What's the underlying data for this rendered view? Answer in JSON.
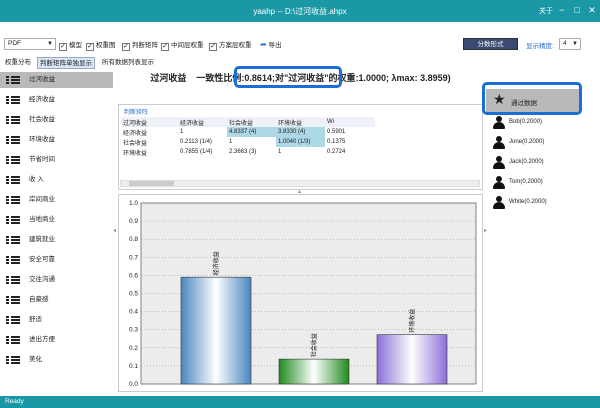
{
  "window": {
    "title": "yaahp -- D:\\过河收益.ahpx",
    "about": "关于",
    "minimize": "−",
    "maximize": "□",
    "close": "✕"
  },
  "toolbar": {
    "format_value": "PDF",
    "checks": [
      {
        "label": "模型",
        "checked": true
      },
      {
        "label": "权重图",
        "checked": true
      },
      {
        "label": "判断矩阵",
        "checked": true
      },
      {
        "label": "中间层权重",
        "checked": true
      },
      {
        "label": "方案层权重",
        "checked": true
      }
    ],
    "export_label": "导出",
    "score_button": "分数形式",
    "precision_label": "显示精度:",
    "precision_value": "4"
  },
  "tabs": [
    {
      "label": "权重分布",
      "active": false
    },
    {
      "label": "判断矩阵单独显示",
      "active": true
    },
    {
      "label": "所有数据列表显示",
      "active": false
    }
  ],
  "nav": [
    {
      "label": "过河收益"
    },
    {
      "label": "经济收益"
    },
    {
      "label": "社会收益"
    },
    {
      "label": "环境收益"
    },
    {
      "label": "节省时间"
    },
    {
      "label": "收 入"
    },
    {
      "label": "岸间商业"
    },
    {
      "label": "当地商业"
    },
    {
      "label": "建筑就业"
    },
    {
      "label": "安全可靠"
    },
    {
      "label": "交往沟通"
    },
    {
      "label": "自豪感"
    },
    {
      "label": "舒适"
    },
    {
      "label": "进出方便"
    },
    {
      "label": "美化"
    }
  ],
  "headline": {
    "node": "过河收益",
    "consistency_label": "一致性比例:",
    "consistency_value": "0.8614;",
    "weight_text": "对\"过河收益\"的权重:",
    "weight_value": "1.0000;",
    "lambda_text": "λmax:",
    "lambda_value": "3.8959)"
  },
  "matrix": {
    "title": "判断矩阵",
    "header": [
      "过河收益",
      "经济收益",
      "社会收益",
      "环境收益",
      "Wi"
    ],
    "rows": [
      [
        "经济收益",
        "1",
        "4.8337 (4)",
        "3.8330 (4)",
        "0.5901"
      ],
      [
        "社会收益",
        "0.2113 (1/4)",
        "1",
        "1.0040 (1/3)",
        "0.1375"
      ],
      [
        "环境收益",
        "0.7855 (1/4)",
        "2.3663 (3)",
        "1",
        "0.2724"
      ]
    ]
  },
  "chart_data": {
    "type": "bar",
    "categories": [
      "经济收益",
      "社会收益",
      "环境收益"
    ],
    "values": [
      0.5901,
      0.1375,
      0.2724
    ],
    "colors": [
      "#4a86c0",
      "#1f8a1f",
      "#8a6fd8"
    ],
    "ylim": [
      0,
      1.0
    ],
    "yticks": [
      "0.0",
      "0.1",
      "0.2",
      "0.3",
      "0.4",
      "0.5",
      "0.6",
      "0.7",
      "0.8",
      "0.9",
      "1.0"
    ],
    "grid": true
  },
  "right": {
    "selected": "通过数据",
    "people": [
      "Bob(0.2000)",
      "Jone(0.2000)",
      "Jack(0.2000)",
      "Tom(0.2000)",
      "White(0.2000)"
    ]
  },
  "status": "Ready"
}
